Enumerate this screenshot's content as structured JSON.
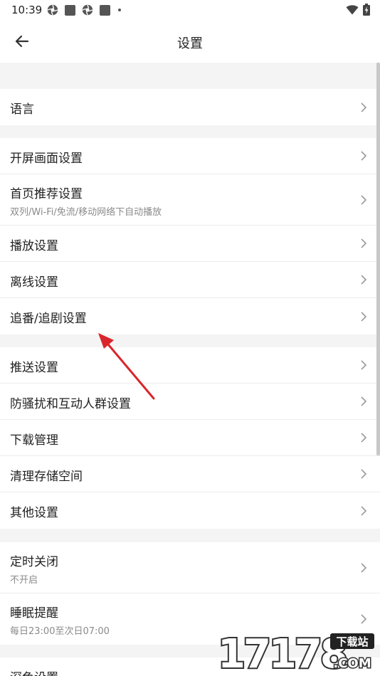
{
  "status_bar": {
    "time": "10:39",
    "left_icons": [
      "aperture-icon",
      "app-square-icon",
      "aperture-icon",
      "app-square-icon",
      "dot-icon"
    ],
    "right_icons": [
      "wifi-icon",
      "battery-charging-icon"
    ]
  },
  "header": {
    "back_icon": "arrow-left-icon",
    "title": "设置"
  },
  "groups": [
    {
      "items": [
        {
          "label": "语言"
        }
      ]
    },
    {
      "items": [
        {
          "label": "开屏画面设置"
        },
        {
          "label": "首页推荐设置",
          "sub": "双列/Wi-Fi/免流/移动网络下自动播放"
        },
        {
          "label": "播放设置"
        },
        {
          "label": "离线设置"
        },
        {
          "label": "追番/追剧设置"
        }
      ]
    },
    {
      "items": [
        {
          "label": "推送设置"
        },
        {
          "label": "防骚扰和互动人群设置"
        },
        {
          "label": "下载管理"
        },
        {
          "label": "清理存储空间"
        },
        {
          "label": "其他设置"
        }
      ]
    },
    {
      "items": [
        {
          "label": "定时关闭",
          "sub": "不开启"
        },
        {
          "label": "睡眠提醒",
          "sub": "每日23:00至次日07:00"
        }
      ]
    },
    {
      "items": [
        {
          "label": "深色设置"
        }
      ]
    }
  ],
  "annotation": {
    "arrow_color": "#d9262c",
    "points_to": "追番/追剧设置"
  },
  "watermark": {
    "brand": "17178",
    "tagline": "下载站",
    "domain": ".COM"
  },
  "colors": {
    "background": "#f4f4f4",
    "divider": "#ececec",
    "subtext": "#8a8a8a"
  }
}
